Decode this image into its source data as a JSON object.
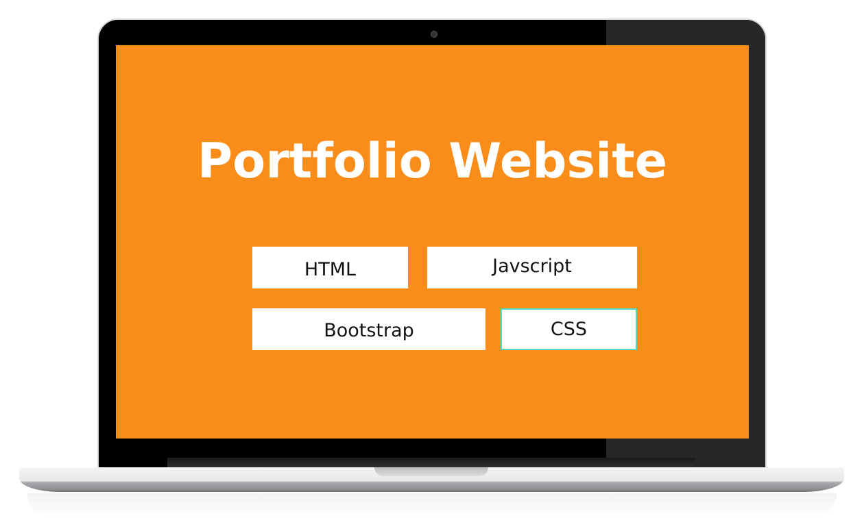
{
  "screen": {
    "title": "Portfolio Website",
    "tags": [
      "HTML",
      "Javscript",
      "Bootstrap",
      "CSS"
    ]
  },
  "colors": {
    "background": "#fa8c19",
    "highlight_border": "#4fd8cc"
  }
}
